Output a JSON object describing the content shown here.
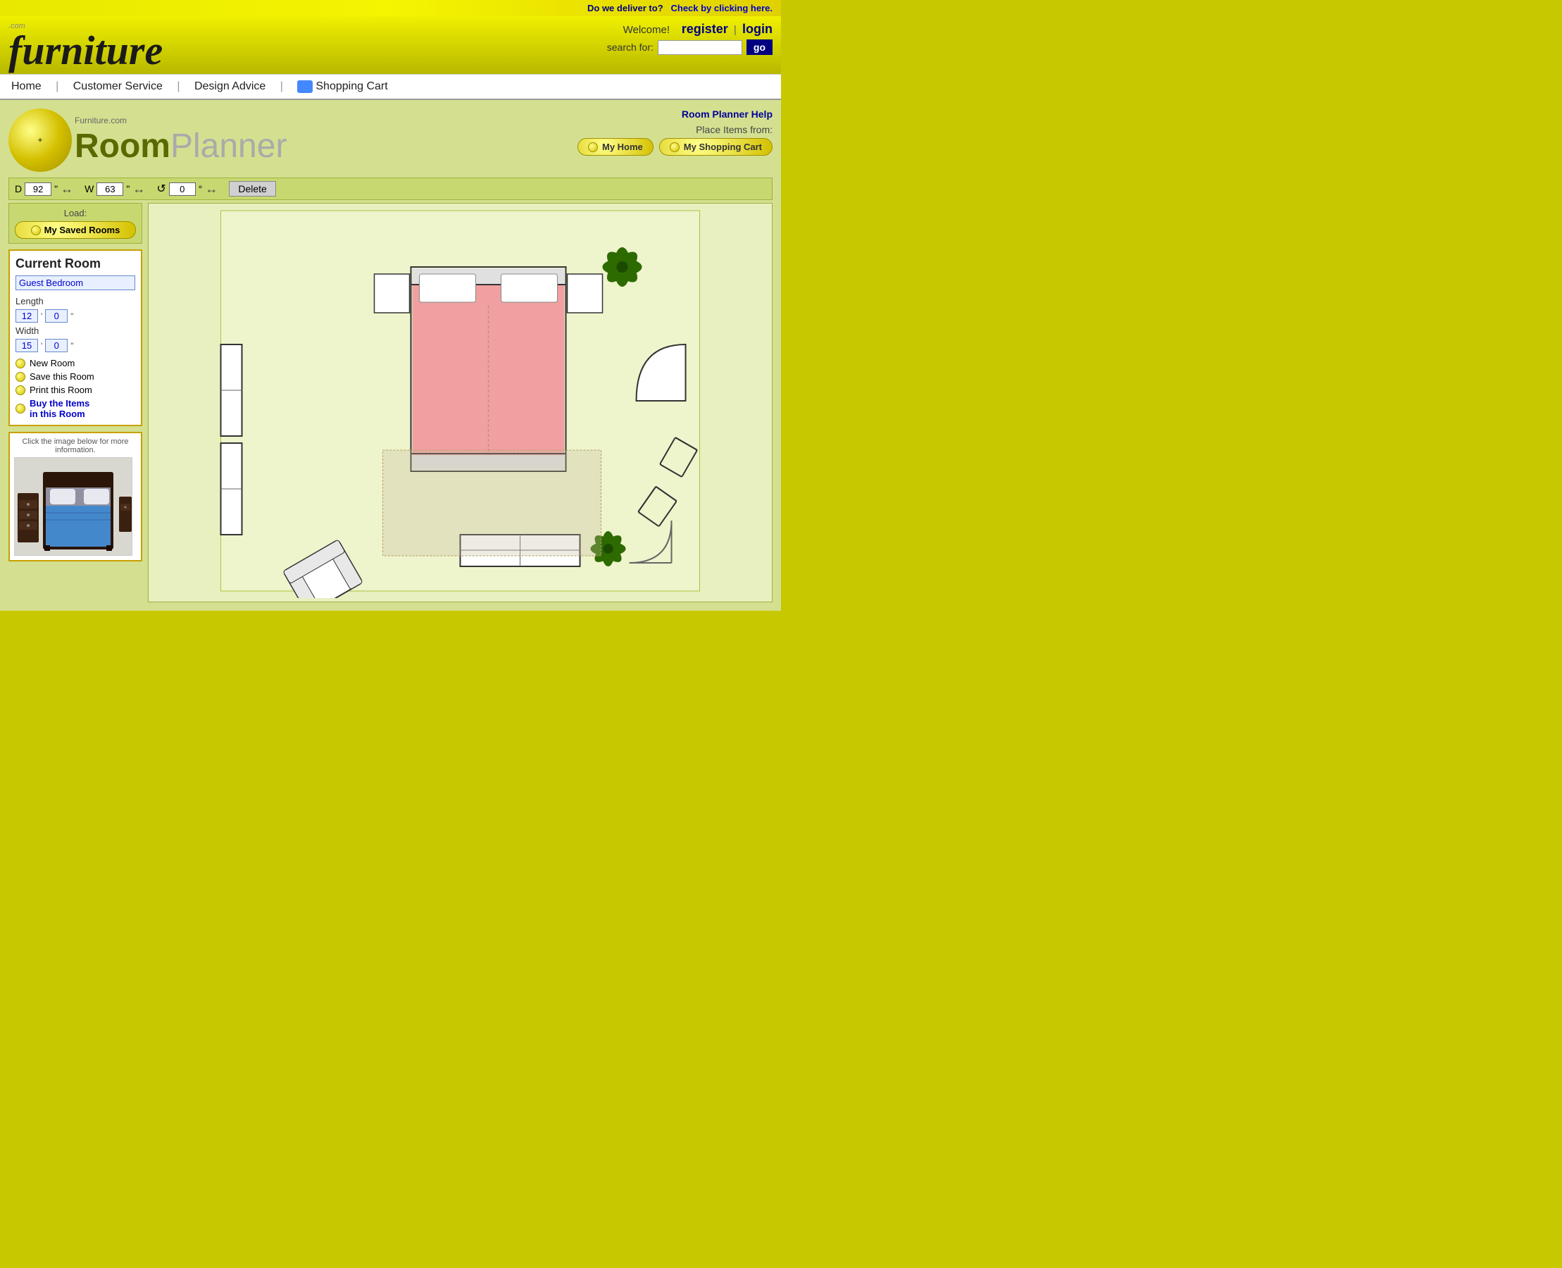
{
  "delivery_bar": {
    "question": "Do we deliver to?",
    "check_label": "Check by clicking here."
  },
  "header": {
    "logo_main": "furniture",
    "logo_dotcom": ".com",
    "welcome": "Welcome!",
    "register": "register",
    "separator": "|",
    "login": "login",
    "search_label": "search for:",
    "search_placeholder": "",
    "go_label": "go"
  },
  "nav": {
    "home": "Home",
    "customer_service": "Customer Service",
    "design_advice": "Design Advice",
    "shopping_cart": "Shopping Cart"
  },
  "planner": {
    "dot_com": "Furniture.com",
    "title_room": "Room",
    "title_planner": "Planner",
    "help_link": "Room Planner Help",
    "place_items_label": "Place Items from:",
    "my_home_btn": "My Home",
    "my_shopping_cart_btn": "My Shopping Cart",
    "toolbar": {
      "d_label": "D",
      "d_value": "92",
      "d_unit": "\"",
      "w_label": "W",
      "w_value": "63",
      "w_unit": "\"",
      "rotate_value": "0",
      "rotate_unit": "°",
      "delete_label": "Delete"
    },
    "load_label": "Load:",
    "my_saved_rooms": "My Saved Rooms",
    "current_room": {
      "title": "Current Room",
      "room_name": "Guest Bedroom",
      "length_label": "Length",
      "length_ft": "12",
      "length_in": "0",
      "width_label": "Width",
      "width_ft": "15",
      "width_in": "0",
      "new_room": "New Room",
      "save_room": "Save this Room",
      "print_room": "Print this Room",
      "buy_items_line1": "Buy the Items",
      "buy_items_line2": "in this Room"
    },
    "product_box": {
      "label": "Click the image below for more information."
    }
  }
}
